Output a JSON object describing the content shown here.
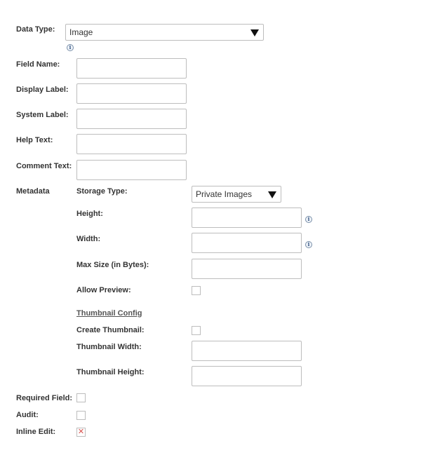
{
  "data_type": {
    "label": "Data Type:",
    "value": "Image"
  },
  "fields": {
    "field_name": "Field Name:",
    "display_label": "Display Label:",
    "system_label": "System Label:",
    "help_text": "Help Text:",
    "comment_text": "Comment Text:"
  },
  "metadata": {
    "label": "Metadata",
    "storage_type": {
      "label": "Storage Type:",
      "value": "Private Images"
    },
    "height": "Height:",
    "width": "Width:",
    "max_size": "Max Size (in Bytes):",
    "allow_preview": "Allow Preview:",
    "thumbnail_config": "Thumbnail Config",
    "create_thumbnail": "Create Thumbnail:",
    "thumbnail_width": "Thumbnail Width:",
    "thumbnail_height": "Thumbnail Height:"
  },
  "flags": {
    "required_field": "Required Field:",
    "audit": "Audit:",
    "inline_edit": "Inline Edit:",
    "inline_edit_mark": "✕"
  },
  "icons": {
    "info": "i"
  },
  "colors": {
    "checked_mark": "#d9534f",
    "border": "#bdbdbd"
  }
}
